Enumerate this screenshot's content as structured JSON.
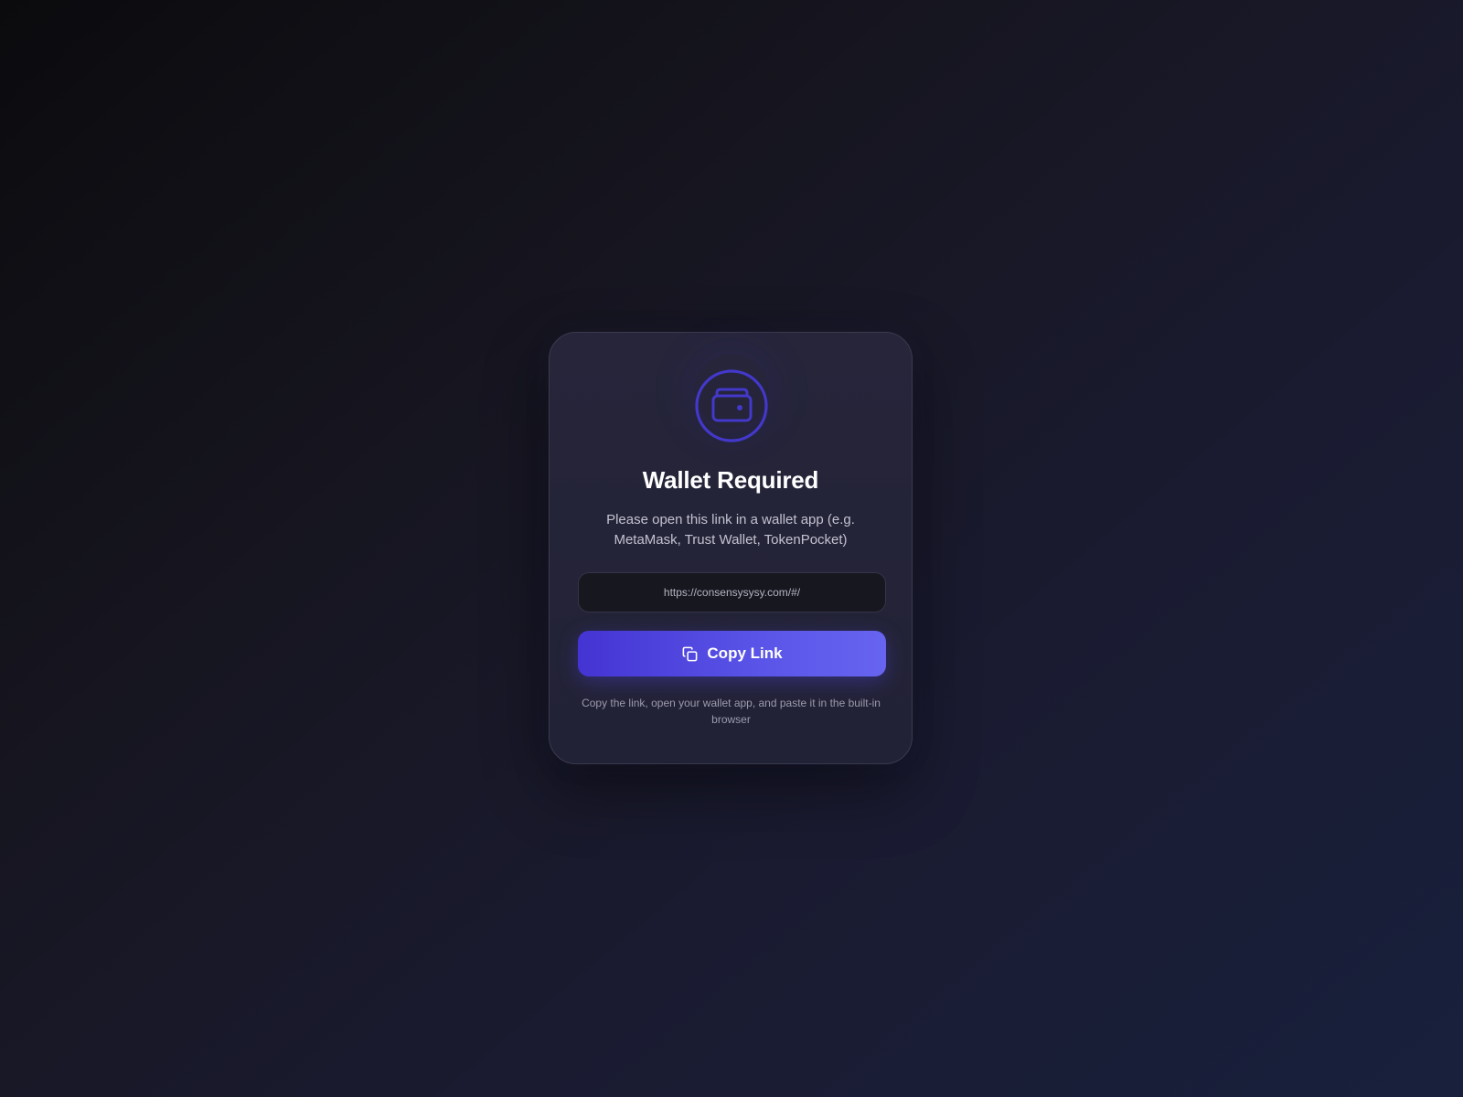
{
  "dialog": {
    "icon": "wallet-icon",
    "title": "Wallet Required",
    "subtitle": "Please open this link in a wallet app (e.g. MetaMask, Trust Wallet, TokenPocket)",
    "url": "https://consensysysy.com/#/",
    "copy_button": {
      "icon": "copy-icon",
      "label": "Copy Link"
    },
    "hint": "Copy the link, open your wallet app, and paste it in the built-in browser"
  },
  "colors": {
    "accent": "#4f46e5",
    "accent_light": "#6366f1",
    "icon_ring": "#4338ca",
    "card_bg": "#25253a",
    "page_bg_start": "#0b0b0e",
    "page_bg_end": "#18203c"
  }
}
